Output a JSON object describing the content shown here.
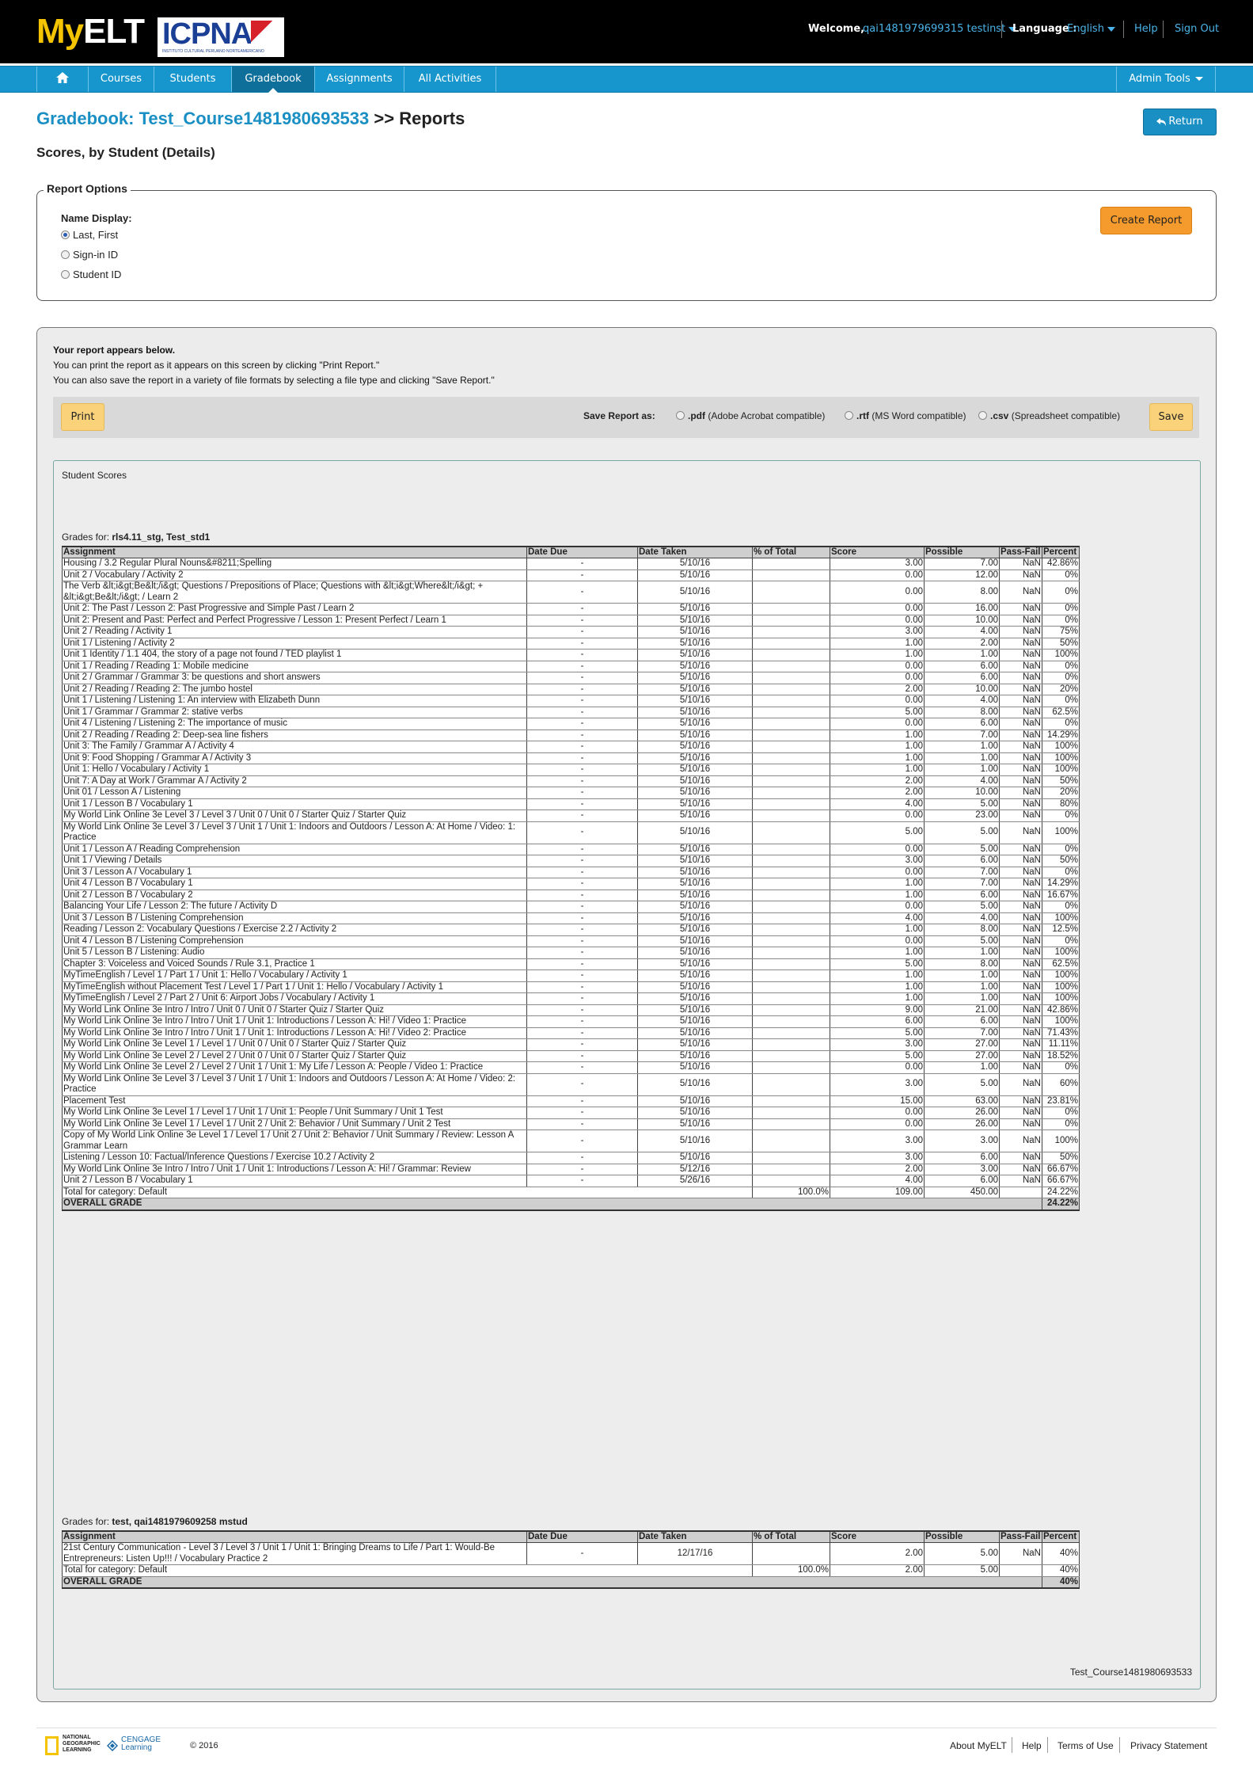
{
  "header": {
    "logo_my": "My",
    "logo_elt": "ELT",
    "partner_logo": "ICPNA",
    "partner_tagline": "INSTITUTO CULTURAL PERUANO NORTEAMERICANO",
    "welcome_label": "Welcome,",
    "user_name": "qai1481979699315 testinst",
    "language_label": "Language :",
    "language_value": "English",
    "help": "Help",
    "sign_out": "Sign Out"
  },
  "nav": {
    "items": [
      "Courses",
      "Students",
      "Gradebook",
      "Assignments",
      "All Activities"
    ],
    "active": "Gradebook",
    "admin_tools": "Admin Tools"
  },
  "page": {
    "title_link": "Gradebook: Test_Course1481980693533",
    "title_rest": ">> Reports",
    "subtitle": "Scores, by Student (Details)",
    "return_button": "Return"
  },
  "report_options": {
    "legend": "Report Options",
    "name_display_label": "Name Display:",
    "options": [
      "Last, First",
      "Sign-in ID",
      "Student ID"
    ],
    "selected": "Last, First",
    "create_button": "Create Report"
  },
  "report_info": {
    "heading": "Your report appears below.",
    "line1": "You can print the report as it appears on this screen by clicking \"Print Report.\"",
    "line2": "You can also save the report in a variety of file formats by selecting a file type and clicking \"Save Report.\""
  },
  "toolbar": {
    "print": "Print",
    "save_as_label": "Save Report as:",
    "formats": [
      {
        "ext": ".pdf",
        "desc": "(Adobe Acrobat compatible)"
      },
      {
        "ext": ".rtf",
        "desc": "(MS Word compatible)"
      },
      {
        "ext": ".csv",
        "desc": "(Spreadsheet compatible)"
      }
    ],
    "save": "Save"
  },
  "scores": {
    "title": "Student Scores",
    "grades_for_label": "Grades for:",
    "columns": [
      "Assignment",
      "Date Due",
      "Date Taken",
      "% of Total",
      "Score",
      "Possible",
      "Pass-Fail",
      "Percent"
    ],
    "students": [
      {
        "name": "rls4.11_stg, Test_std1",
        "rows": [
          [
            "Housing / 3.2 Regular Plural Nouns&#8211;Spelling",
            "-",
            "5/10/16",
            "",
            "3.00",
            "7.00",
            "NaN",
            "42.86%"
          ],
          [
            "Unit 2 / Vocabulary / Activity 2",
            "-",
            "5/10/16",
            "",
            "0.00",
            "12.00",
            "NaN",
            "0%"
          ],
          [
            "The Verb &lt;i&gt;Be&lt;/i&gt; Questions / Prepositions of Place; Questions with &lt;i&gt;Where&lt;/i&gt; + &lt;i&gt;Be&lt;/i&gt; / Learn 2",
            "-",
            "5/10/16",
            "",
            "0.00",
            "8.00",
            "NaN",
            "0%"
          ],
          [
            "Unit 2: The Past / Lesson 2: Past Progressive and Simple Past / Learn 2",
            "-",
            "5/10/16",
            "",
            "0.00",
            "16.00",
            "NaN",
            "0%"
          ],
          [
            "Unit 2: Present and Past: Perfect and Perfect Progressive / Lesson 1: Present Perfect / Learn 1",
            "-",
            "5/10/16",
            "",
            "0.00",
            "10.00",
            "NaN",
            "0%"
          ],
          [
            "Unit 2 / Reading / Activity 1",
            "-",
            "5/10/16",
            "",
            "3.00",
            "4.00",
            "NaN",
            "75%"
          ],
          [
            "Unit 1 / Listening / Activity 2",
            "-",
            "5/10/16",
            "",
            "1.00",
            "2.00",
            "NaN",
            "50%"
          ],
          [
            "Unit 1 Identity / 1.1 404, the story of a page not found / TED playlist 1",
            "-",
            "5/10/16",
            "",
            "1.00",
            "1.00",
            "NaN",
            "100%"
          ],
          [
            "Unit 1 / Reading / Reading 1: Mobile medicine",
            "-",
            "5/10/16",
            "",
            "0.00",
            "6.00",
            "NaN",
            "0%"
          ],
          [
            "Unit 2 / Grammar / Grammar 3: be questions and short answers",
            "-",
            "5/10/16",
            "",
            "0.00",
            "6.00",
            "NaN",
            "0%"
          ],
          [
            "Unit 2 / Reading / Reading 2: The jumbo hostel",
            "-",
            "5/10/16",
            "",
            "2.00",
            "10.00",
            "NaN",
            "20%"
          ],
          [
            "Unit 1 / Listening / Listening 1: An interview with Elizabeth Dunn",
            "-",
            "5/10/16",
            "",
            "0.00",
            "4.00",
            "NaN",
            "0%"
          ],
          [
            "Unit 1 / Grammar / Grammar 2: stative verbs",
            "-",
            "5/10/16",
            "",
            "5.00",
            "8.00",
            "NaN",
            "62.5%"
          ],
          [
            "Unit 4 / Listening / Listening 2: The importance of music",
            "-",
            "5/10/16",
            "",
            "0.00",
            "6.00",
            "NaN",
            "0%"
          ],
          [
            "Unit 2 / Reading / Reading 2: Deep-sea line fishers",
            "-",
            "5/10/16",
            "",
            "1.00",
            "7.00",
            "NaN",
            "14.29%"
          ],
          [
            "Unit 3: The Family / Grammar A / Activity 4",
            "-",
            "5/10/16",
            "",
            "1.00",
            "1.00",
            "NaN",
            "100%"
          ],
          [
            "Unit 9: Food Shopping / Grammar A / Activity 3",
            "-",
            "5/10/16",
            "",
            "1.00",
            "1.00",
            "NaN",
            "100%"
          ],
          [
            "Unit 1: Hello / Vocabulary / Activity 1",
            "-",
            "5/10/16",
            "",
            "1.00",
            "1.00",
            "NaN",
            "100%"
          ],
          [
            "Unit 7: A Day at Work / Grammar A / Activity 2",
            "-",
            "5/10/16",
            "",
            "2.00",
            "4.00",
            "NaN",
            "50%"
          ],
          [
            "Unit 01 / Lesson A / Listening",
            "-",
            "5/10/16",
            "",
            "2.00",
            "10.00",
            "NaN",
            "20%"
          ],
          [
            "Unit 1 / Lesson B / Vocabulary 1",
            "-",
            "5/10/16",
            "",
            "4.00",
            "5.00",
            "NaN",
            "80%"
          ],
          [
            "My World Link Online 3e Level 3 / Level 3 / Unit 0 / Unit 0 / Starter Quiz / Starter Quiz",
            "-",
            "5/10/16",
            "",
            "0.00",
            "23.00",
            "NaN",
            "0%"
          ],
          [
            "My World Link Online 3e Level 3 / Level 3 / Unit 1 / Unit 1: Indoors and Outdoors / Lesson A: At Home / Video: 1: Practice",
            "-",
            "5/10/16",
            "",
            "5.00",
            "5.00",
            "NaN",
            "100%"
          ],
          [
            "Unit 1 / Lesson A / Reading Comprehension",
            "-",
            "5/10/16",
            "",
            "0.00",
            "5.00",
            "NaN",
            "0%"
          ],
          [
            "Unit 1 / Viewing / Details",
            "-",
            "5/10/16",
            "",
            "3.00",
            "6.00",
            "NaN",
            "50%"
          ],
          [
            "Unit 3 / Lesson A / Vocabulary 1",
            "-",
            "5/10/16",
            "",
            "0.00",
            "7.00",
            "NaN",
            "0%"
          ],
          [
            "Unit 4 / Lesson B / Vocabulary 1",
            "-",
            "5/10/16",
            "",
            "1.00",
            "7.00",
            "NaN",
            "14.29%"
          ],
          [
            "Unit 2 / Lesson B / Vocabulary 2",
            "-",
            "5/10/16",
            "",
            "1.00",
            "6.00",
            "NaN",
            "16.67%"
          ],
          [
            "Balancing Your Life / Lesson 2: The future / Activity D",
            "-",
            "5/10/16",
            "",
            "0.00",
            "5.00",
            "NaN",
            "0%"
          ],
          [
            "Unit 3 / Lesson B / Listening Comprehension",
            "-",
            "5/10/16",
            "",
            "4.00",
            "4.00",
            "NaN",
            "100%"
          ],
          [
            "Reading / Lesson 2: Vocabulary Questions / Exercise 2.2 / Activity 2",
            "-",
            "5/10/16",
            "",
            "1.00",
            "8.00",
            "NaN",
            "12.5%"
          ],
          [
            "Unit 4 / Lesson B / Listening Comprehension",
            "-",
            "5/10/16",
            "",
            "0.00",
            "5.00",
            "NaN",
            "0%"
          ],
          [
            "Unit 5 / Lesson B / Listening: Audio",
            "-",
            "5/10/16",
            "",
            "1.00",
            "1.00",
            "NaN",
            "100%"
          ],
          [
            "Chapter 3: Voiceless and Voiced Sounds / Rule 3.1, Practice 1",
            "-",
            "5/10/16",
            "",
            "5.00",
            "8.00",
            "NaN",
            "62.5%"
          ],
          [
            "MyTimeEnglish / Level 1 / Part 1 / Unit 1: Hello / Vocabulary / Activity 1",
            "-",
            "5/10/16",
            "",
            "1.00",
            "1.00",
            "NaN",
            "100%"
          ],
          [
            "MyTimeEnglish without Placement Test / Level 1 / Part 1 / Unit 1: Hello / Vocabulary / Activity 1",
            "-",
            "5/10/16",
            "",
            "1.00",
            "1.00",
            "NaN",
            "100%"
          ],
          [
            "MyTimeEnglish / Level 2 / Part 2 / Unit 6: Airport Jobs / Vocabulary / Activity 1",
            "-",
            "5/10/16",
            "",
            "1.00",
            "1.00",
            "NaN",
            "100%"
          ],
          [
            "My World Link Online 3e Intro / Intro / Unit 0 / Unit 0 / Starter Quiz / Starter Quiz",
            "-",
            "5/10/16",
            "",
            "9.00",
            "21.00",
            "NaN",
            "42.86%"
          ],
          [
            "My World Link Online 3e Intro / Intro / Unit 1 / Unit 1: Introductions / Lesson A: Hi! / Video 1: Practice",
            "-",
            "5/10/16",
            "",
            "6.00",
            "6.00",
            "NaN",
            "100%"
          ],
          [
            "My World Link Online 3e Intro / Intro / Unit 1 / Unit 1: Introductions / Lesson A: Hi! / Video 2: Practice",
            "-",
            "5/10/16",
            "",
            "5.00",
            "7.00",
            "NaN",
            "71.43%"
          ],
          [
            "My World Link Online 3e Level 1 / Level 1 / Unit 0 / Unit 0 / Starter Quiz / Starter Quiz",
            "-",
            "5/10/16",
            "",
            "3.00",
            "27.00",
            "NaN",
            "11.11%"
          ],
          [
            "My World Link Online 3e Level 2 / Level 2 / Unit 0 / Unit 0 / Starter Quiz / Starter Quiz",
            "-",
            "5/10/16",
            "",
            "5.00",
            "27.00",
            "NaN",
            "18.52%"
          ],
          [
            "My World Link Online 3e Level 2 / Level 2 / Unit 1 / Unit 1: My Life / Lesson A: People / Video 1: Practice",
            "-",
            "5/10/16",
            "",
            "0.00",
            "1.00",
            "NaN",
            "0%"
          ],
          [
            "My World Link Online 3e Level 3 / Level 3 / Unit 1 / Unit 1: Indoors and Outdoors / Lesson A: At Home / Video: 2: Practice",
            "-",
            "5/10/16",
            "",
            "3.00",
            "5.00",
            "NaN",
            "60%"
          ],
          [
            "Placement Test",
            "-",
            "5/10/16",
            "",
            "15.00",
            "63.00",
            "NaN",
            "23.81%"
          ],
          [
            "My World Link Online 3e Level 1 / Level 1 / Unit 1 / Unit 1: People / Unit Summary / Unit 1 Test",
            "-",
            "5/10/16",
            "",
            "0.00",
            "26.00",
            "NaN",
            "0%"
          ],
          [
            "My World Link Online 3e Level 1 / Level 1 / Unit 2 / Unit 2: Behavior / Unit Summary / Unit 2 Test",
            "-",
            "5/10/16",
            "",
            "0.00",
            "26.00",
            "NaN",
            "0%"
          ],
          [
            "Copy of My World Link Online 3e Level 1 / Level 1 / Unit 2 / Unit 2: Behavior / Unit Summary / Review: Lesson A Grammar Learn",
            "-",
            "5/10/16",
            "",
            "3.00",
            "3.00",
            "NaN",
            "100%"
          ],
          [
            "Listening / Lesson 10: Factual/Inference Questions / Exercise 10.2 / Activity 2",
            "-",
            "5/10/16",
            "",
            "3.00",
            "6.00",
            "NaN",
            "50%"
          ],
          [
            "My World Link Online 3e Intro / Intro / Unit 1 / Unit 1: Introductions / Lesson A: Hi! / Grammar: Review",
            "-",
            "5/12/16",
            "",
            "2.00",
            "3.00",
            "NaN",
            "66.67%"
          ],
          [
            "Unit 2 / Lesson B / Vocabulary 1",
            "-",
            "5/26/16",
            "",
            "4.00",
            "6.00",
            "NaN",
            "66.67%"
          ]
        ],
        "total": [
          "Total for category: Default",
          "100.0%",
          "109.00",
          "450.00",
          "24.22%"
        ],
        "overall": [
          "OVERALL GRADE",
          "24.22%"
        ]
      },
      {
        "name": "test, qai1481979609258 mstud",
        "rows": [
          [
            "21st Century Communication - Level 3 / Level 3 / Unit 1 / Unit 1: Bringing Dreams to Life / Part 1: Would-Be Entrepreneurs: Listen Up!!! / Vocabulary Practice 2",
            "-",
            "12/17/16",
            "",
            "2.00",
            "5.00",
            "NaN",
            "40%"
          ]
        ],
        "total": [
          "Total for category: Default",
          "100.0%",
          "2.00",
          "5.00",
          "40%"
        ],
        "overall": [
          "OVERALL GRADE",
          "40%"
        ]
      }
    ],
    "course_footer": "Test_Course1481980693533"
  },
  "footer": {
    "ng_logo": "NATIONAL GEOGRAPHIC LEARNING",
    "cengage_logo": "CENGAGE Learning",
    "copyright": "© 2016",
    "links": [
      "About MyELT",
      "Help",
      "Terms of Use",
      "Privacy Statement"
    ]
  },
  "colors": {
    "accent_blue": "#1a8fc4",
    "nav_blue": "#1696cc",
    "orange_button": "#f59a2c",
    "yellow_button": "#fad27a"
  }
}
